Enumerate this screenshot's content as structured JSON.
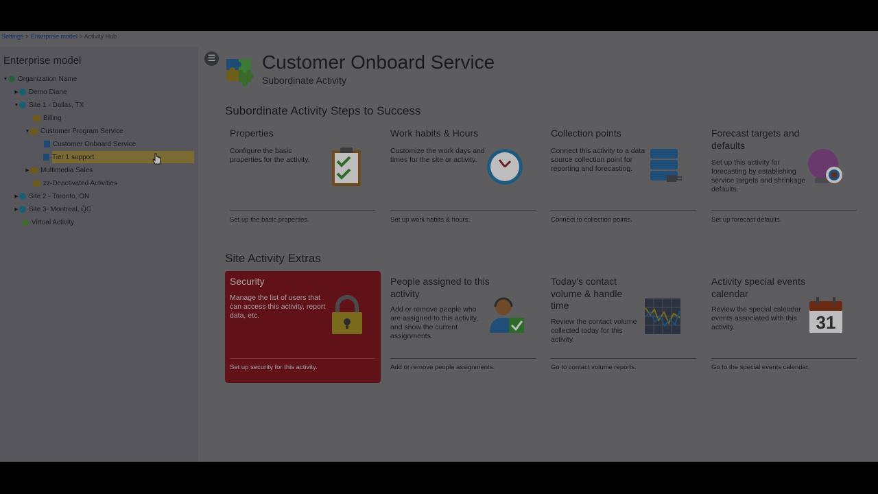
{
  "breadcrumb": {
    "settings": "Settings",
    "enterprise_model": "Enterprise model",
    "activity_hub": "Activity Hub",
    "sep": ">"
  },
  "sidebar": {
    "title": "Enterprise model",
    "items": [
      {
        "label": "Organization Name",
        "icon": "globe-icon"
      },
      {
        "label": "Demo Diane",
        "icon": "globe-icon"
      },
      {
        "label": "Site 1 - Dallas, TX",
        "icon": "globe-icon"
      },
      {
        "label": "Billing",
        "icon": "folder-icon"
      },
      {
        "label": "Customer Program Service",
        "icon": "folder-icon"
      },
      {
        "label": "Customer Onboard Service",
        "icon": "document-icon"
      },
      {
        "label": "Tier 1 support",
        "icon": "document-icon"
      },
      {
        "label": "Multimedia Sales",
        "icon": "folder-icon"
      },
      {
        "label": "zz-Deactivated Activities",
        "icon": "folder-icon"
      },
      {
        "label": "Site 2 - Toronto, ON",
        "icon": "globe-icon"
      },
      {
        "label": "Site 3- Montreal, QC",
        "icon": "globe-icon"
      },
      {
        "label": "Virtual Activity",
        "icon": "pin-icon"
      }
    ]
  },
  "header": {
    "title": "Customer Onboard Service",
    "subtitle": "Subordinate Activity",
    "menu_icon": "menu-icon"
  },
  "steps": {
    "title": "Subordinate Activity Steps to Success",
    "cards": [
      {
        "title": "Properties",
        "desc": "Configure the basic properties for the activity.",
        "foot": "Set up the basic properties.",
        "icon": "clipboard-check-icon"
      },
      {
        "title": "Work habits & Hours",
        "desc": "Customize the work days and times for the site or activity.",
        "foot": "Set up work habits & hours.",
        "icon": "clock-icon"
      },
      {
        "title": "Collection points",
        "desc": "Connect this activity to a data source collection point for reporting and forecasting.",
        "foot": "Connect to collection points.",
        "icon": "database-plug-icon"
      },
      {
        "title": "Forecast targets and defaults",
        "desc": "Set up this activity for forecasting by establishing service targets and shrinkage defaults.",
        "foot": "Set up forecast defaults.",
        "icon": "crystal-ball-target-icon"
      }
    ]
  },
  "extras": {
    "title": "Site Activity Extras",
    "cards": [
      {
        "title": "Security",
        "desc": "Manage the list of users that can access this activity, report data, etc.",
        "foot": "Set up security for this activity.",
        "icon": "padlock-icon"
      },
      {
        "title": "People assigned to this activity",
        "desc": "Add or remove people who are assigned to this activity, and show the current assignments.",
        "foot": "Add or remove people assignments.",
        "icon": "person-headset-icon"
      },
      {
        "title": "Today's contact volume & handle time",
        "desc": "Review the contact volume collected today for this activity.",
        "foot": "Go to contact volume reports.",
        "icon": "line-chart-icon"
      },
      {
        "title": "Activity special events calendar",
        "desc": "Review the special calendar events associated with this activity.",
        "foot": "Go to the special events calendar.",
        "icon": "calendar-icon",
        "calendar_day": "31"
      }
    ]
  },
  "colors": {
    "overlay_background": "#5d5d60",
    "security_card": "#611219",
    "selected_row": "#7b6b33"
  }
}
